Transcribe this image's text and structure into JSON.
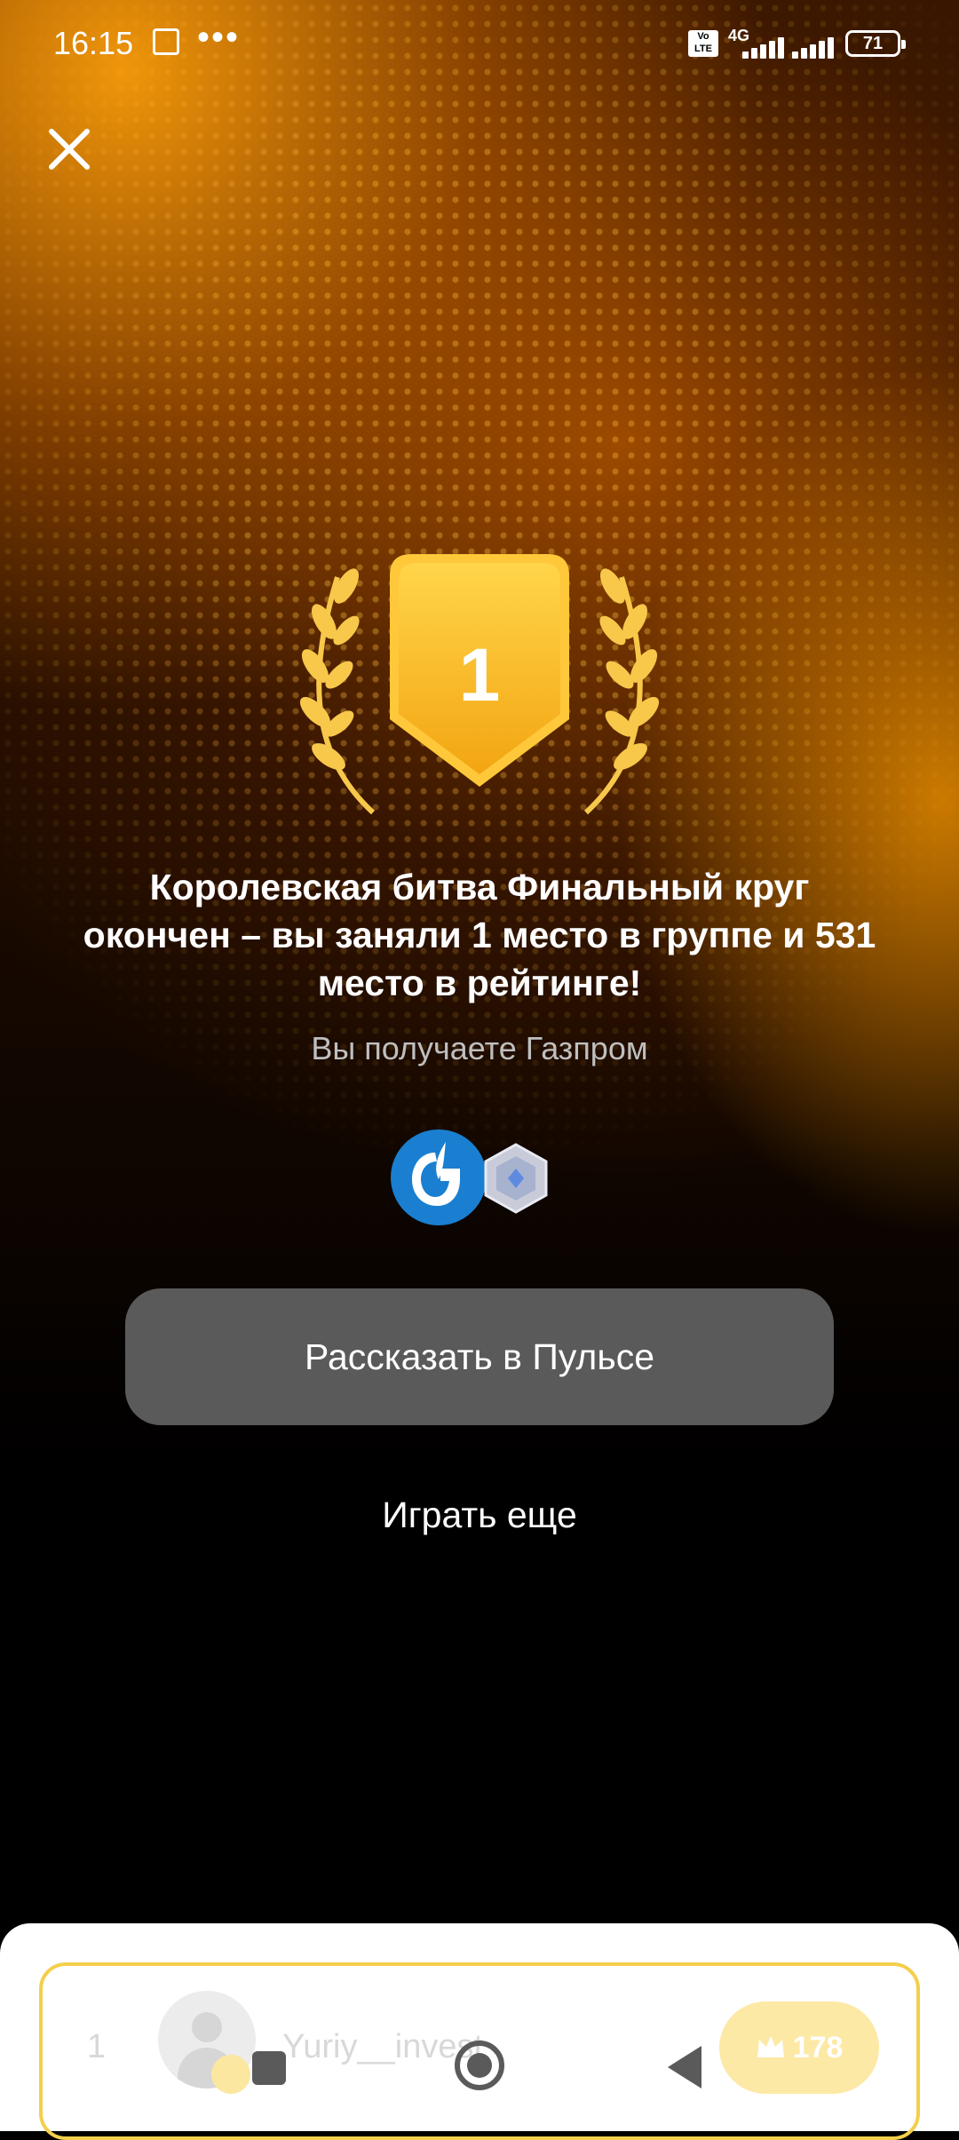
{
  "status_bar": {
    "time": "16:15",
    "more": "•••",
    "volte": "Vo\nLTE",
    "network": "4G",
    "battery": "71"
  },
  "result": {
    "place_badge": "1",
    "headline": "Королевская битва Финальный круг окончен – вы заняли 1 место в группе и 531 место в рейтинге!",
    "subtitle": "Вы получаете Газпром"
  },
  "actions": {
    "share_label": "Рассказать в Пульсе",
    "play_again_label": "Играть еще"
  },
  "leaderboard_row": {
    "rank": "1",
    "username": "Yuriy__invest",
    "score": "178"
  },
  "colors": {
    "accent_gold": "#f6b21c",
    "gazprom_blue": "#1a7fd0",
    "button_gray": "#5a5a5a",
    "row_border": "#f3cf4c"
  },
  "icons": {
    "close": "close-icon",
    "gazprom": "gazprom-logo-icon",
    "gem": "crystal-icon",
    "laurel": "laurel-icon",
    "score": "crown-icon"
  }
}
